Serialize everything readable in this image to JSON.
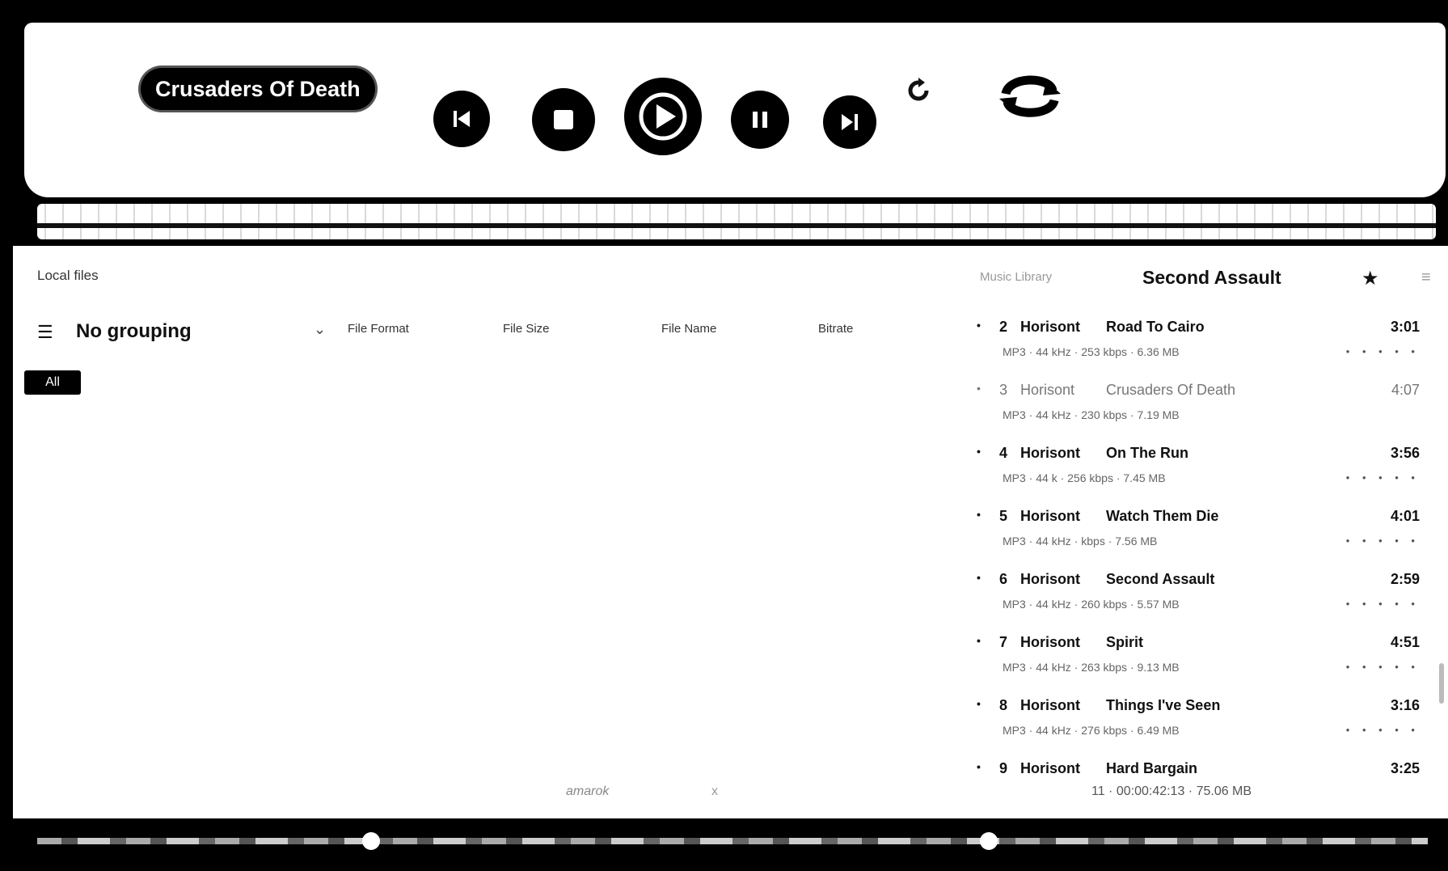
{
  "player": {
    "now_playing_title": "Crusaders Of Death"
  },
  "library": {
    "source_label": "Local files",
    "grouping_label": "No grouping",
    "columns": [
      "File Format",
      "File Size",
      "File Name",
      "Bitrate"
    ],
    "badge_label": "All",
    "center_hint": "amarok",
    "center_hint_extra": "x"
  },
  "queue": {
    "source_label": "Music Library",
    "current_title": "Second Assault",
    "tracks": [
      {
        "num": "2",
        "artist": "Horisont",
        "title": "Road To Cairo",
        "duration": "3:01",
        "meta": "MP3 · 44 kHz · 253 kbps · 6.36 MB",
        "rating": "• • • • •",
        "dim": false
      },
      {
        "num": "3",
        "artist": "Horisont",
        "title": "Crusaders Of Death",
        "duration": "4:07",
        "meta": "MP3 · 44 kHz · 230 kbps · 7.19 MB",
        "rating": "",
        "dim": true
      },
      {
        "num": "4",
        "artist": "Horisont",
        "title": "On The Run",
        "duration": "3:56",
        "meta": "MP3 · 44 k · 256 kbps · 7.45 MB",
        "rating": "• • • • •",
        "dim": false
      },
      {
        "num": "5",
        "artist": "Horisont",
        "title": "Watch Them Die",
        "duration": "4:01",
        "meta": "MP3 · 44 kHz · kbps · 7.56 MB",
        "rating": "• • • • •",
        "dim": false
      },
      {
        "num": "6",
        "artist": "Horisont",
        "title": "Second Assault",
        "duration": "2:59",
        "meta": "MP3 · 44 kHz · 260 kbps · 5.57 MB",
        "rating": "• • • • •",
        "dim": false
      },
      {
        "num": "7",
        "artist": "Horisont",
        "title": "Spirit",
        "duration": "4:51",
        "meta": "MP3 · 44 kHz · 263 kbps · 9.13 MB",
        "rating": "• • • • •",
        "dim": false
      },
      {
        "num": "8",
        "artist": "Horisont",
        "title": "Things I've Seen",
        "duration": "3:16",
        "meta": "MP3 · 44 kHz · 276 kbps · 6.49 MB",
        "rating": "• • • • •",
        "dim": false
      },
      {
        "num": "9",
        "artist": "Horisont",
        "title": "Hard Bargain",
        "duration": "3:25",
        "meta": "",
        "rating": "",
        "dim": false
      }
    ],
    "footer": "11 · 00:00:42:13 · 75.06 MB"
  },
  "colors": {
    "background": "#ffffff",
    "chrome": "#000000",
    "accent": "#ffffff"
  },
  "icons": [
    "previous-icon",
    "stop-icon",
    "play-icon",
    "pause-icon",
    "next-icon",
    "refresh-icon",
    "repeat-icon",
    "grouping-icon",
    "star-icon",
    "menu-icon"
  ]
}
